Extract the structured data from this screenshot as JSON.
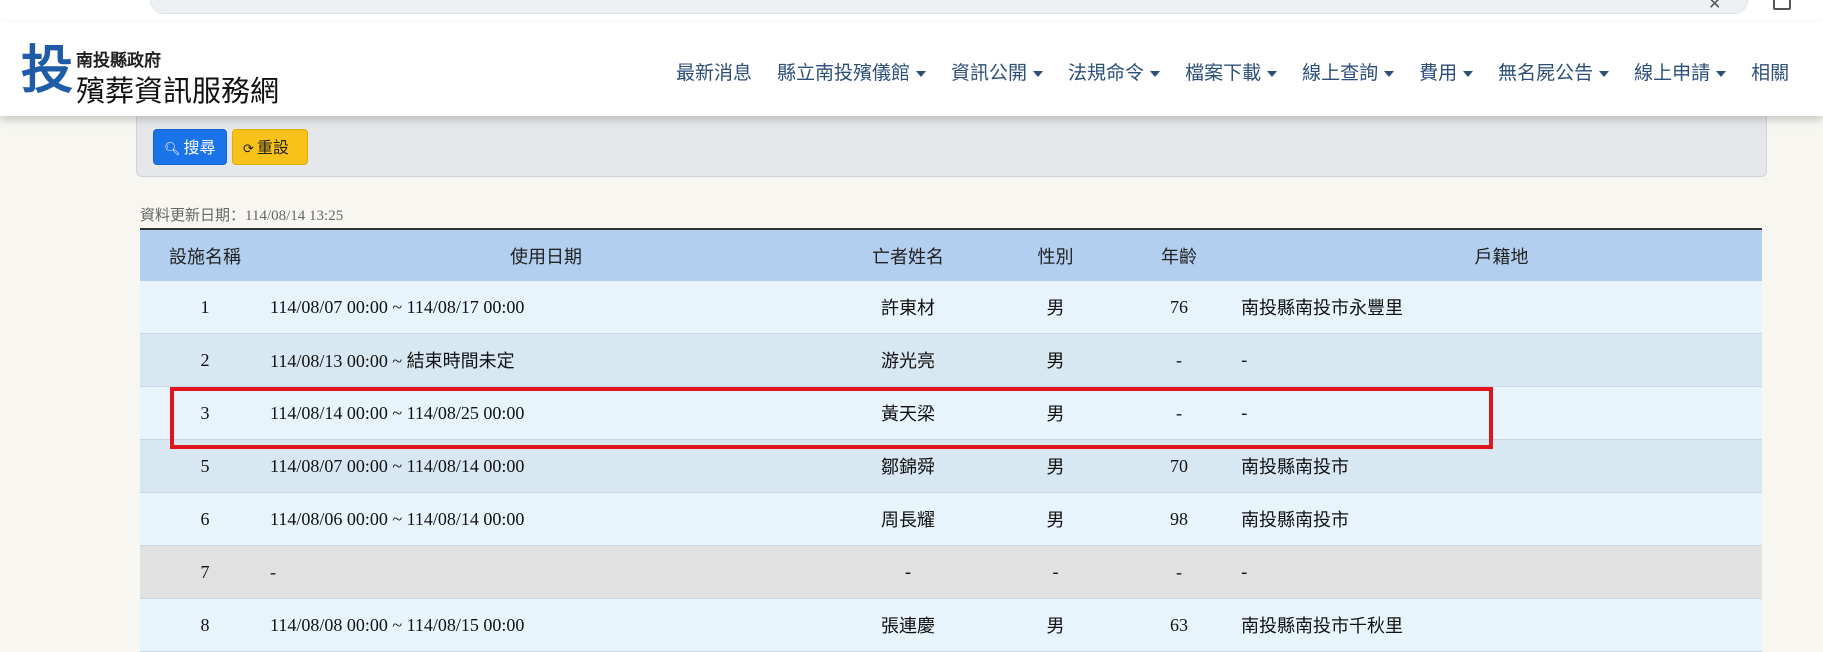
{
  "header": {
    "logo_char": "投",
    "site_name_small": "南投縣政府",
    "site_name_big": "殯葬資訊服務網",
    "nav": [
      {
        "label": "最新消息",
        "dropdown": false
      },
      {
        "label": "縣立南投殯儀館",
        "dropdown": true
      },
      {
        "label": "資訊公開",
        "dropdown": true
      },
      {
        "label": "法規命令",
        "dropdown": true
      },
      {
        "label": "檔案下載",
        "dropdown": true
      },
      {
        "label": "線上查詢",
        "dropdown": true
      },
      {
        "label": "費用",
        "dropdown": true
      },
      {
        "label": "無名屍公告",
        "dropdown": true
      },
      {
        "label": "線上申請",
        "dropdown": true
      },
      {
        "label": "相關",
        "dropdown": false
      }
    ]
  },
  "search": {
    "search_label": "搜尋",
    "reset_label": "重設",
    "search_icon": "search-icon",
    "reset_icon": "reset-icon"
  },
  "update_info": "資料更新日期：114/08/14 13:25",
  "table": {
    "columns": [
      "設施名稱",
      "使用日期",
      "亡者姓名",
      "性別",
      "年齡",
      "戶籍地"
    ],
    "rows": [
      {
        "facility": "1",
        "date": "114/08/07 00:00 ~ 114/08/17 00:00",
        "name": "許東材",
        "gender": "男",
        "age": "76",
        "address": "南投縣南投市永豐里"
      },
      {
        "facility": "2",
        "date": "114/08/13 00:00 ~ ",
        "date_note": "結束時間未定",
        "name": "游光亮",
        "gender": "男",
        "age": "-",
        "address": "-"
      },
      {
        "facility": "3",
        "date": "114/08/14 00:00 ~ 114/08/25 00:00",
        "name": "黃天梁",
        "gender": "男",
        "age": "-",
        "address": "-"
      },
      {
        "facility": "5",
        "date": "114/08/07 00:00 ~ 114/08/14 00:00",
        "name": "鄒錦舜",
        "gender": "男",
        "age": "70",
        "address": "南投縣南投市"
      },
      {
        "facility": "6",
        "date": "114/08/06 00:00 ~ 114/08/14 00:00",
        "name": "周長耀",
        "gender": "男",
        "age": "98",
        "address": "南投縣南投市"
      },
      {
        "facility": "7",
        "date": "-",
        "name": "-",
        "gender": "-",
        "age": "-",
        "address": "-"
      },
      {
        "facility": "8",
        "date": "114/08/08 00:00 ~ 114/08/15 00:00",
        "name": "張連慶",
        "gender": "男",
        "age": "63",
        "address": "南投縣南投市千秋里"
      }
    ]
  },
  "colors": {
    "header_bg": "#b3cff0",
    "highlight_border": "#e0141a",
    "search_button": "#1a73e8",
    "reset_button": "#f8c21a"
  }
}
